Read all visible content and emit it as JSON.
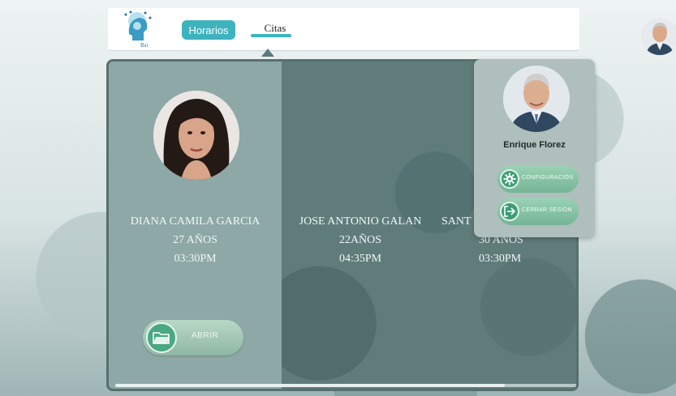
{
  "nav": {
    "tabs": [
      {
        "label": "Horarios",
        "active": false
      },
      {
        "label": "Citas",
        "active": true
      }
    ],
    "logo_text": "Bsi"
  },
  "patients": [
    {
      "name": "DIANA CAMILA GARCIA",
      "age": "27 AÑOS",
      "time": "03:30PM"
    },
    {
      "name": "JOSE ANTONIO GALAN",
      "age": "22AÑOS",
      "time": "04:35PM"
    },
    {
      "name": "SANT",
      "age": "30 AÑOS",
      "time": "03:30PM"
    }
  ],
  "actions": {
    "open_label": "ABRIR"
  },
  "user_menu": {
    "name": "Enrique Florez",
    "items": [
      {
        "label": "CONFIGURACIÓN",
        "icon": "gear-icon"
      },
      {
        "label": "CERRAR SESIÓN",
        "icon": "logout-icon"
      }
    ]
  },
  "colors": {
    "accent": "#3db3bd",
    "panel": "#5f7c7b",
    "card": "#8da8a6",
    "button": "#4aa882"
  }
}
